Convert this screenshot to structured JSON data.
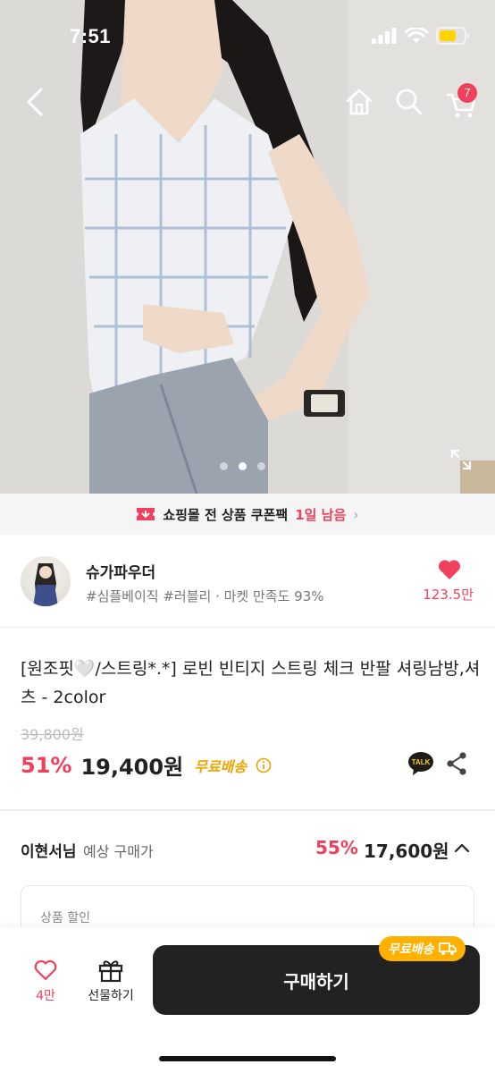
{
  "status_bar": {
    "time": "7:51"
  },
  "header": {
    "cart_count": "7",
    "image_pages": 3,
    "active_page": 2
  },
  "coupon_banner": {
    "text": "쇼핑몰 전 상품 쿠폰팩",
    "highlight": "1일 남음"
  },
  "store": {
    "name": "슈가파우더",
    "tags": "#심플베이직 #러블리 · 마켓 만족도 93%",
    "favorites": "123.5만"
  },
  "product": {
    "title": "[원조핏🤍/스트링*.*] 로빈 빈티지 스트링 체크 반팔 셔링남방,셔츠 - 2color",
    "original_price": "39,800원",
    "discount": "51%",
    "price": "19,400원",
    "free_shipping": "무료배송"
  },
  "member_price": {
    "name": "이현서님",
    "label": "예상 구매가",
    "discount": "55%",
    "price": "17,600원"
  },
  "discount_section": {
    "label": "상품 할인"
  },
  "bottom_bar": {
    "likes": "4만",
    "gift_label": "선물하기",
    "buy_label": "구매하기",
    "shipping_badge": "무료배송"
  },
  "colors": {
    "accent": "#f2405c",
    "dark": "#222222",
    "shipping": "#ffb000"
  }
}
